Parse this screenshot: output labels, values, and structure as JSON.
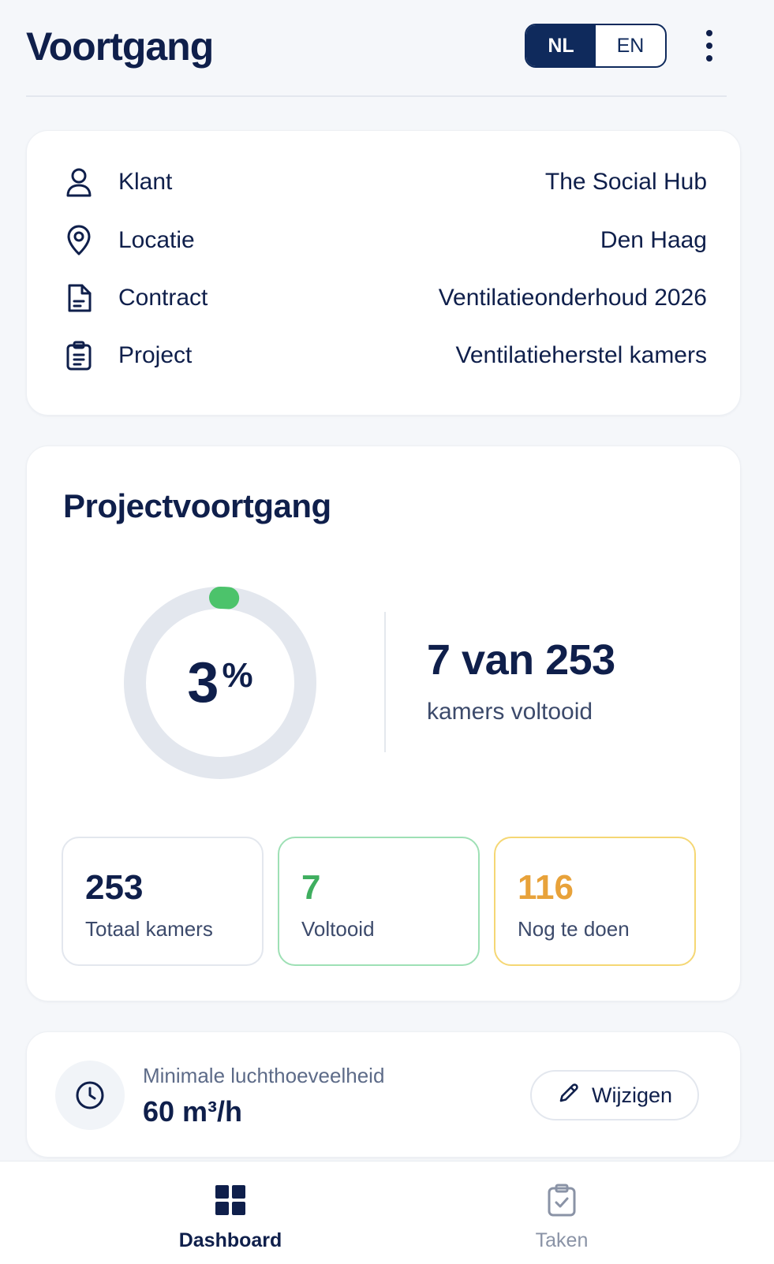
{
  "header": {
    "title": "Voortgang",
    "lang_active": "NL",
    "lang_inactive": "EN"
  },
  "info": {
    "rows": [
      {
        "icon": "user-icon",
        "label": "Klant",
        "value": "The Social Hub"
      },
      {
        "icon": "location-pin-icon",
        "label": "Locatie",
        "value": "Den Haag"
      },
      {
        "icon": "document-icon",
        "label": "Contract",
        "value": "Ventilatieonderhoud 2026"
      },
      {
        "icon": "clipboard-list-icon",
        "label": "Project",
        "value": "Ventilatieherstel kamers"
      }
    ]
  },
  "progress": {
    "title": "Projectvoortgang",
    "percent": "3",
    "percent_symbol": "%",
    "fraction": 0.03,
    "count_text": "7 van 253",
    "count_sub": "kamers voltooid",
    "stats": {
      "total": {
        "value": "253",
        "label": "Totaal kamers"
      },
      "done": {
        "value": "7",
        "label": "Voltooid"
      },
      "todo": {
        "value": "116",
        "label": "Nog te doen"
      }
    },
    "colors": {
      "ring_track": "#e3e7ee",
      "ring_fill": "#4cc36b"
    }
  },
  "airflow": {
    "label": "Minimale luchthoeveelheid",
    "value": "60 m³/h",
    "edit_label": "Wijzigen"
  },
  "nav": {
    "dashboard": "Dashboard",
    "tasks": "Taken"
  }
}
